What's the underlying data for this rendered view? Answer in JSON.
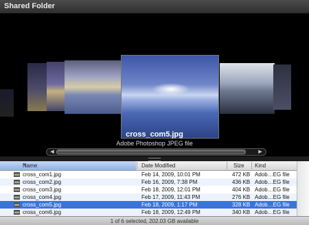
{
  "window": {
    "title": "Shared Folder"
  },
  "coverflow": {
    "selected_title": "cross_com5.jpg",
    "selected_kind": "Adobe Photoshop JPEG file",
    "scroll_left_icon": "◀",
    "scroll_right_icon": "▶"
  },
  "list": {
    "columns": {
      "name": "Name",
      "date": "Date Modified",
      "size": "Size",
      "kind": "Kind"
    },
    "sort_icon": "▲",
    "rows": [
      {
        "name": "cross_com1.jpg",
        "date": "Feb 14, 2009, 10:01 PM",
        "size": "472 KB",
        "kind": "Adob…EG file"
      },
      {
        "name": "cross_com2.jpg",
        "date": "Feb 16, 2009, 7:38 PM",
        "size": "436 KB",
        "kind": "Adob…EG file"
      },
      {
        "name": "cross_com3.jpg",
        "date": "Feb 18, 2009, 12:01 PM",
        "size": "404 KB",
        "kind": "Adob…EG file"
      },
      {
        "name": "cross_com4.jpg",
        "date": "Feb 17, 2009, 11:43 PM",
        "size": "276 KB",
        "kind": "Adob…EG file"
      },
      {
        "name": "cross_com5.jpg",
        "date": "Feb 18, 2009, 1:17 PM",
        "size": "328 KB",
        "kind": "Adob…EG file"
      },
      {
        "name": "cross_com6.jpg",
        "date": "Feb 18, 2009, 12:49 PM",
        "size": "340 KB",
        "kind": "Adob…EG file"
      }
    ]
  },
  "status": {
    "text": "1 of 6 selected, 202.03 GB available"
  }
}
